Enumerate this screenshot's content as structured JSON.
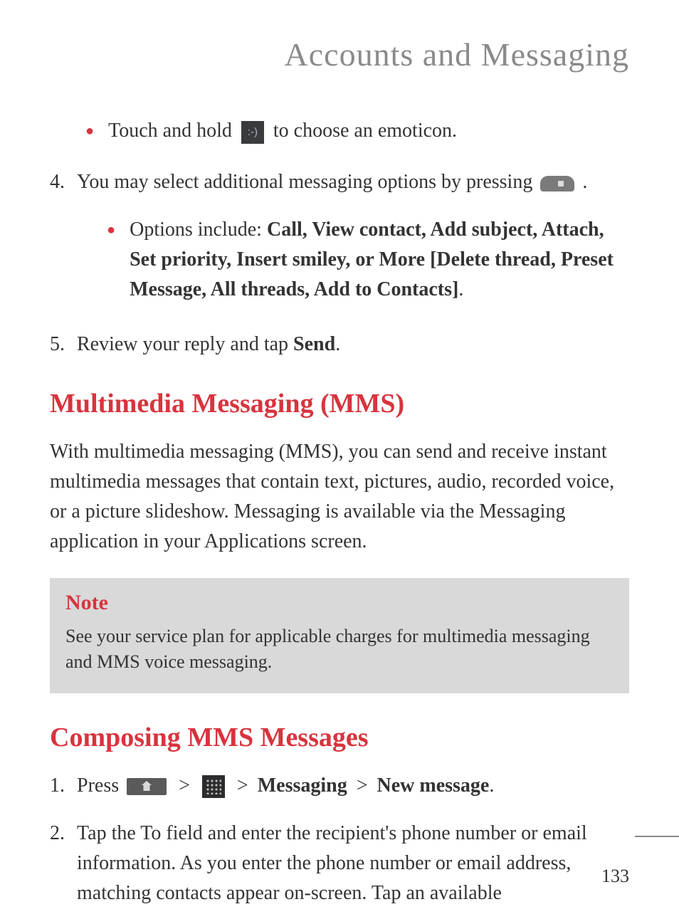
{
  "page": {
    "title": "Accounts and Messaging",
    "number": "133"
  },
  "content": {
    "bullet1_pre": "Touch and hold ",
    "bullet1_post": " to choose an emoticon.",
    "step4_pre": "You may select additional messaging options by pressing ",
    "step4_post": ".",
    "step4_num": "4.",
    "bullet2_intro": "Options include: ",
    "bullet2_bold": "Call, View contact, Add subject, Attach, Set priority, Insert smiley, or More [Delete thread, Preset Message, All threads, Add to Contacts]",
    "bullet2_end": ".",
    "step5_num": "5.",
    "step5_pre": "Review your reply and tap ",
    "step5_bold": "Send",
    "step5_end": "."
  },
  "mms": {
    "heading": "Multimedia Messaging (MMS)",
    "body": "With multimedia messaging (MMS), you can send and receive instant multimedia messages that contain text, pictures, audio, recorded voice, or a picture slideshow. Messaging is available via the Messaging application in your Applications screen."
  },
  "note": {
    "title": "Note",
    "text": "See your service plan for applicable charges for multimedia messaging and MMS voice messaging."
  },
  "composing": {
    "heading": "Composing MMS Messages",
    "step1_num": "1.",
    "step1_pre": "Press ",
    "step1_chev1": " > ",
    "step1_chev2": " > ",
    "step1_messaging": "Messaging",
    "step1_chev3": " > ",
    "step1_newmsg": "New message",
    "step1_end": ".",
    "step2_num": "2.",
    "step2_text": "Tap the To field and enter the recipient's phone number or email information. As you enter the phone number or email address, matching contacts appear on-screen. Tap an available"
  }
}
